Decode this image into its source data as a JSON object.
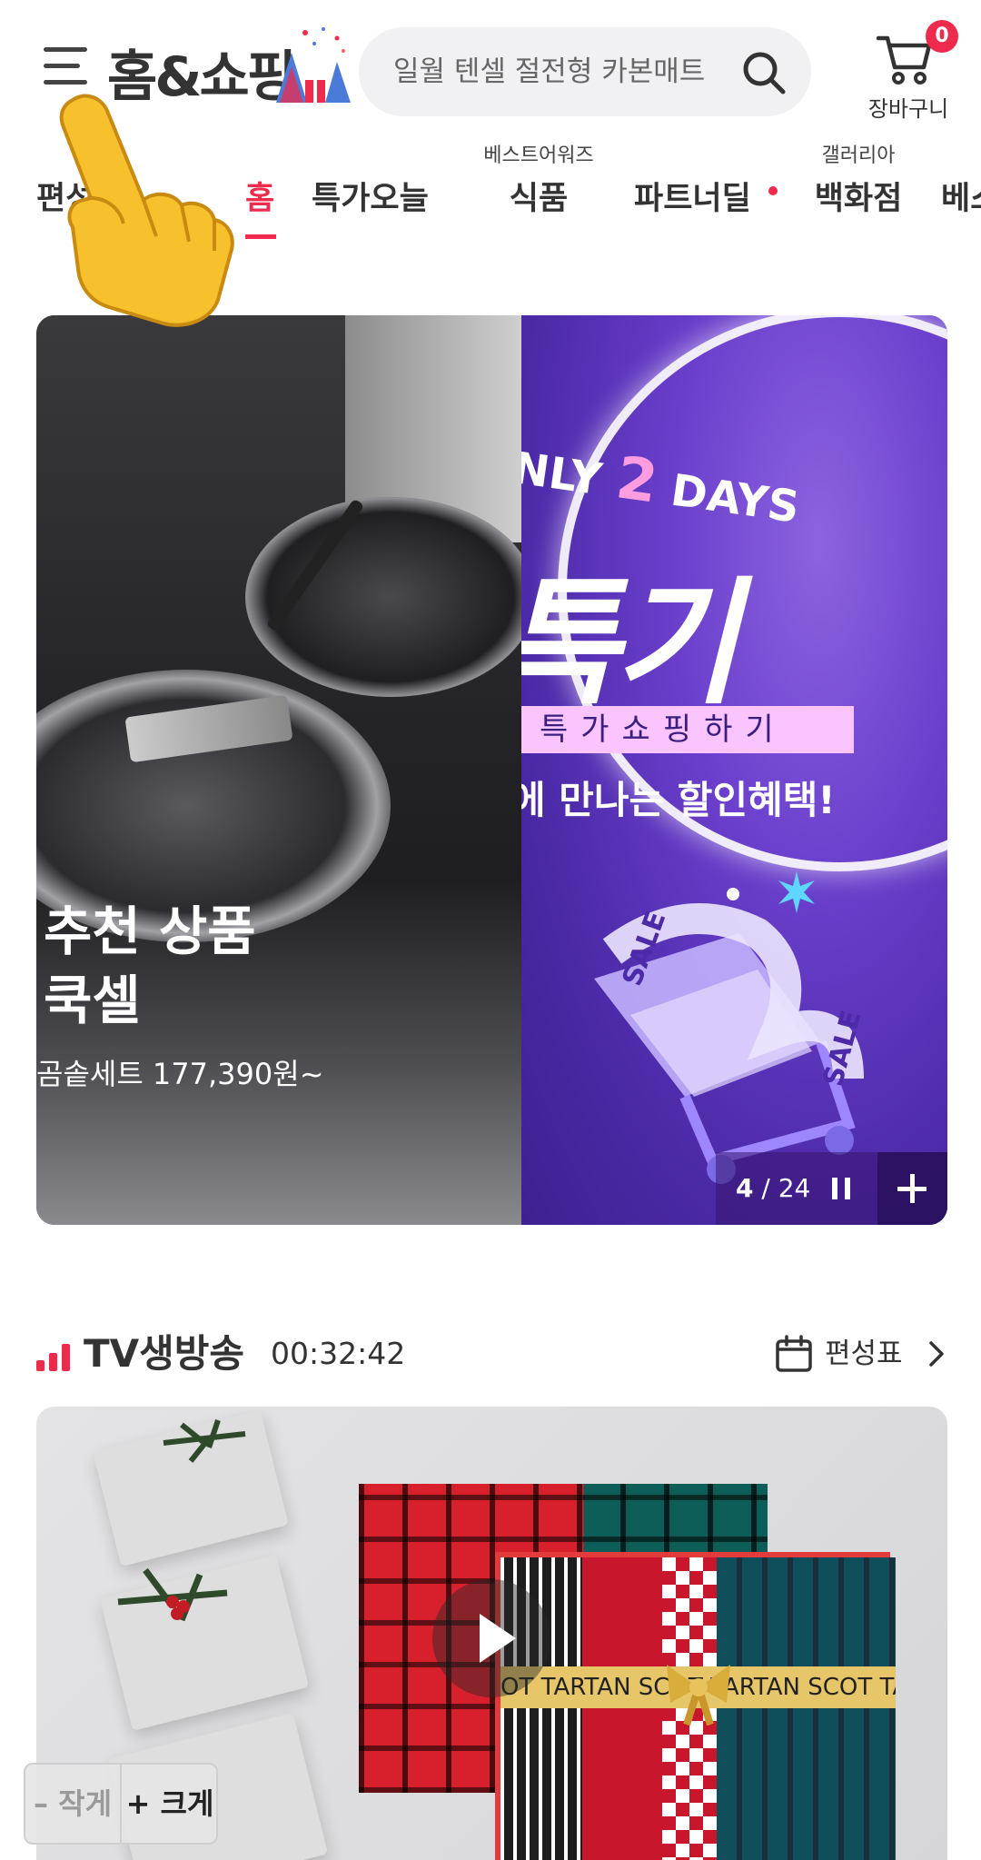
{
  "header": {
    "logo_text": "홈&쇼핑",
    "search_placeholder": "일월 텐셀 절전형 카본매트",
    "cart_label": "장바구니",
    "cart_count": "0"
  },
  "nav": {
    "items": [
      {
        "label": "편성표",
        "sub": ""
      },
      {
        "label": "홈",
        "sub": "",
        "active": true
      },
      {
        "label": "특가오늘",
        "sub": ""
      },
      {
        "label": "식품",
        "sub": "베스트어워즈"
      },
      {
        "label": "파트너딜",
        "sub": "",
        "has_dot": true
      },
      {
        "label": "백화점",
        "sub": "갤러리아"
      },
      {
        "label": "베스",
        "sub": ""
      }
    ]
  },
  "banner": {
    "left_title_line1": "추천 상품",
    "left_title_line2": "쿡셀",
    "left_subtitle": "곰솥세트 177,390원~",
    "right_days": {
      "pre": "NLY ",
      "num": "2",
      "post": " DAYS"
    },
    "right_title": "특기",
    "right_pinkbar": "특가쇼핑하기",
    "right_text": "에 만나는 할인혜택!",
    "sale_tag": "SALE",
    "current_slide": "4",
    "total_slides": "/ 24"
  },
  "tv_live": {
    "title": "TV생방송",
    "timer": "00:32:42",
    "schedule_label": "편성표",
    "tartan_text": "OT TARTAN   SCOT TARTAN   SCOT TA"
  },
  "font_control": {
    "smaller": "– 작게",
    "bigger": "+ 크게"
  },
  "colors": {
    "accent": "#ee2b4d",
    "banner_purple": "#6a3fcc"
  }
}
